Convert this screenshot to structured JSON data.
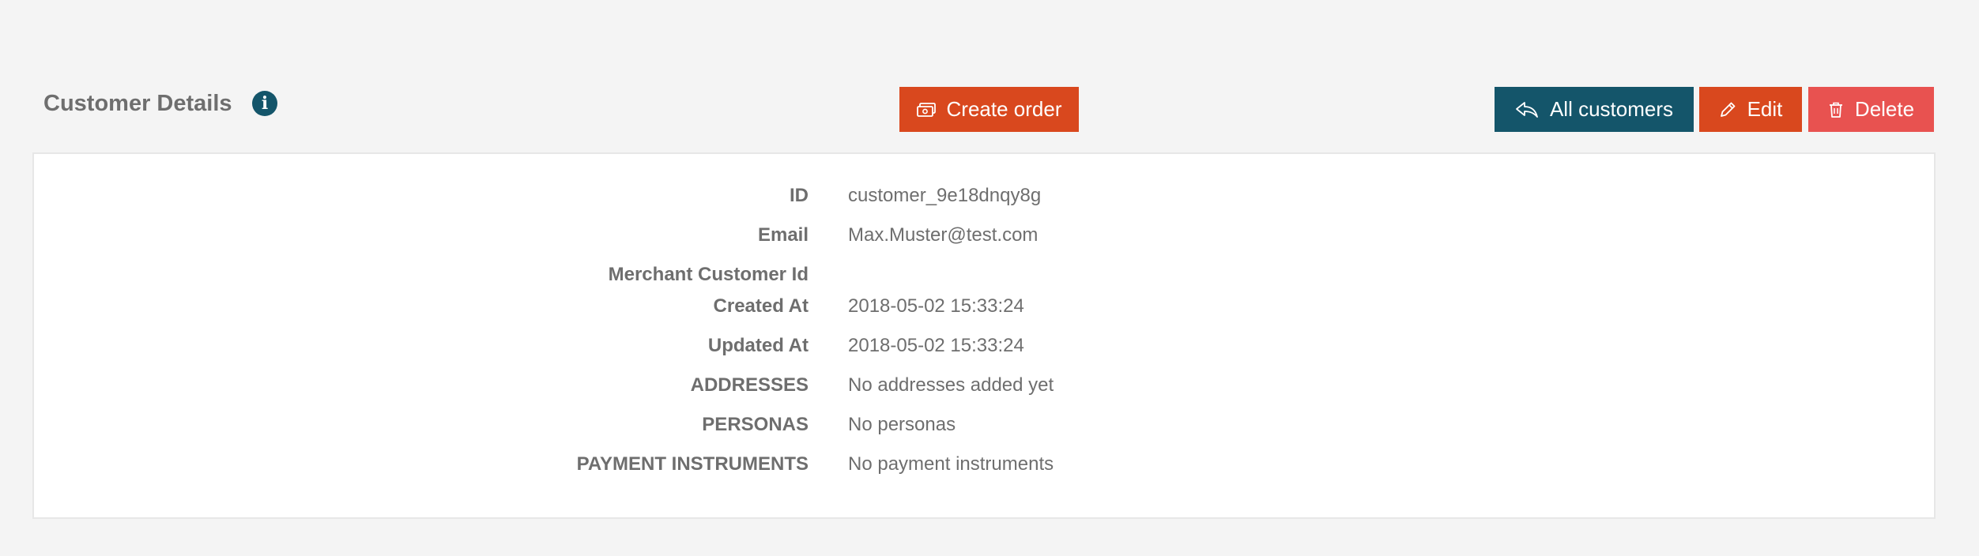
{
  "header": {
    "title": "Customer Details",
    "info_icon": "info-icon",
    "buttons": {
      "create_order": {
        "label": "Create order",
        "icon": "money-icon",
        "color": "#d9481e"
      },
      "all_customers": {
        "label": "All customers",
        "icon": "reply-arrow-icon",
        "color": "#14556a"
      },
      "edit": {
        "label": "Edit",
        "icon": "pencil-icon",
        "color": "#d9481e"
      },
      "delete": {
        "label": "Delete",
        "icon": "trash-icon",
        "color": "#e85250"
      }
    }
  },
  "details": [
    {
      "label": "ID",
      "value": "customer_9e18dnqy8g"
    },
    {
      "label": "Email",
      "value": "Max.Muster@test.com"
    },
    {
      "label": "Merchant Customer Id",
      "value": ""
    },
    {
      "label": "Created At",
      "value": "2018-05-02 15:33:24"
    },
    {
      "label": "Updated At",
      "value": "2018-05-02 15:33:24"
    },
    {
      "label": "ADDRESSES",
      "value": "No addresses added yet"
    },
    {
      "label": "PERSONAS",
      "value": "No personas"
    },
    {
      "label": "PAYMENT INSTRUMENTS",
      "value": "No payment instruments"
    }
  ]
}
